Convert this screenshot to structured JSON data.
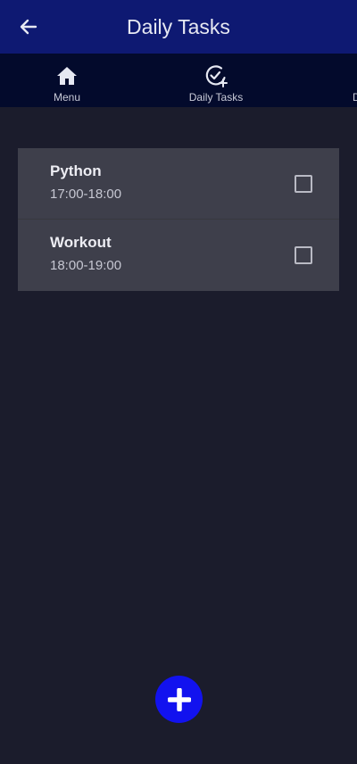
{
  "app_bar": {
    "title": "Daily Tasks",
    "back_icon": "arrow-left-icon",
    "background": "#0e1972"
  },
  "tabs": [
    {
      "label": "Menu",
      "icon": "home-icon"
    },
    {
      "label": "Daily Tasks",
      "icon": "check-circle-icon"
    },
    {
      "label": "D",
      "icon": "unknown-icon"
    }
  ],
  "tasks": [
    {
      "name": "Python",
      "time": "17:00-18:00",
      "checked": false
    },
    {
      "name": "Workout",
      "time": "18:00-19:00",
      "checked": false
    }
  ],
  "fab": {
    "icon": "plus-icon",
    "color": "#1212ef"
  },
  "colors": {
    "background": "#1b1c2c",
    "tab_bar": "#030a2c",
    "card": "#3e3f4b"
  }
}
